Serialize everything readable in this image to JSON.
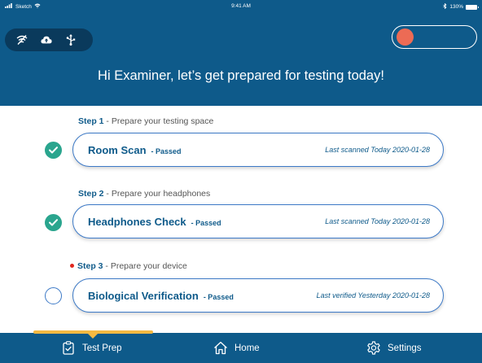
{
  "status_bar": {
    "carrier": "Sketch",
    "time": "9:41 AM",
    "battery": "130%"
  },
  "header": {
    "greeting": "Hi Examiner, let’s get prepared for testing today!",
    "toolbar_icons": [
      "wifi-off-icon",
      "cloud-upload-icon",
      "usb-icon"
    ],
    "toggle_color": "#ec6b55"
  },
  "steps": [
    {
      "step_number": "Step 1",
      "step_desc": " - Prepare your testing space",
      "title": "Room Scan",
      "status": "- Passed",
      "meta": "Last scanned Today 2020-01-28",
      "completed": true,
      "alert": false
    },
    {
      "step_number": "Step 2",
      "step_desc": " - Prepare your headphones",
      "title": "Headphones Check",
      "status": "- Passed",
      "meta": "Last scanned Today 2020-01-28",
      "completed": true,
      "alert": false
    },
    {
      "step_number": "Step 3",
      "step_desc": " - Prepare your device",
      "title": "Biological Verification",
      "status": "- Passed",
      "meta": "Last verified Yesterday 2020-01-28",
      "completed": false,
      "alert": true
    }
  ],
  "tabbar": {
    "active_tab": "Test Prep",
    "tabs": [
      {
        "label": "Test Prep",
        "icon": "clipboard-check-icon"
      },
      {
        "label": "Home",
        "icon": "home-icon"
      },
      {
        "label": "Settings",
        "icon": "gear-icon"
      }
    ]
  },
  "colors": {
    "brand_blue": "#0e5a8a",
    "success_green": "#2aa58e",
    "alert_red": "#e0271f",
    "accent_yellow": "#f5b942"
  }
}
